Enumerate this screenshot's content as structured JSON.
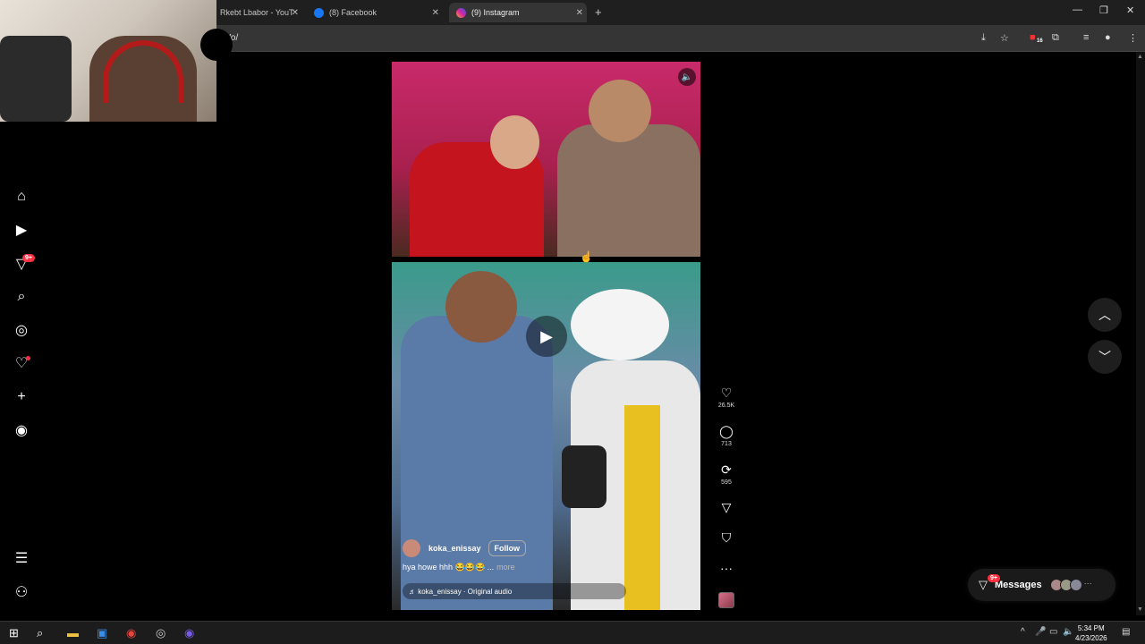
{
  "browser": {
    "tabs": [
      {
        "title": "Rkebt Lbabor - YouT",
        "favicon": "youtube-icon",
        "active": false
      },
      {
        "title": "(8) Facebook",
        "favicon": "facebook-icon",
        "active": false
      },
      {
        "title": "(9) Instagram",
        "favicon": "instagram-icon",
        "active": true
      }
    ],
    "url": "KWo/",
    "extension_badge": "16"
  },
  "sidebar": {
    "notification_badge": "9+"
  },
  "reel": {
    "username": "koka_enissay",
    "follow_label": "Follow",
    "caption": "hya howe hhh 😂😂😂 ...",
    "more_label": "more",
    "audio": "♬ koka_enissay · Original audio"
  },
  "actions": {
    "likes": "26.5K",
    "comments": "713",
    "reposts": "595"
  },
  "messages": {
    "label": "Messages",
    "badge": "9+"
  },
  "taskbar": {
    "time": "5:34 PM",
    "date": "4/23/2026"
  },
  "colors": {
    "accent_red": "#ff3040",
    "reel_top_bg": "#c92a6a",
    "reel_bottom_bg": "#3a9b8a"
  }
}
